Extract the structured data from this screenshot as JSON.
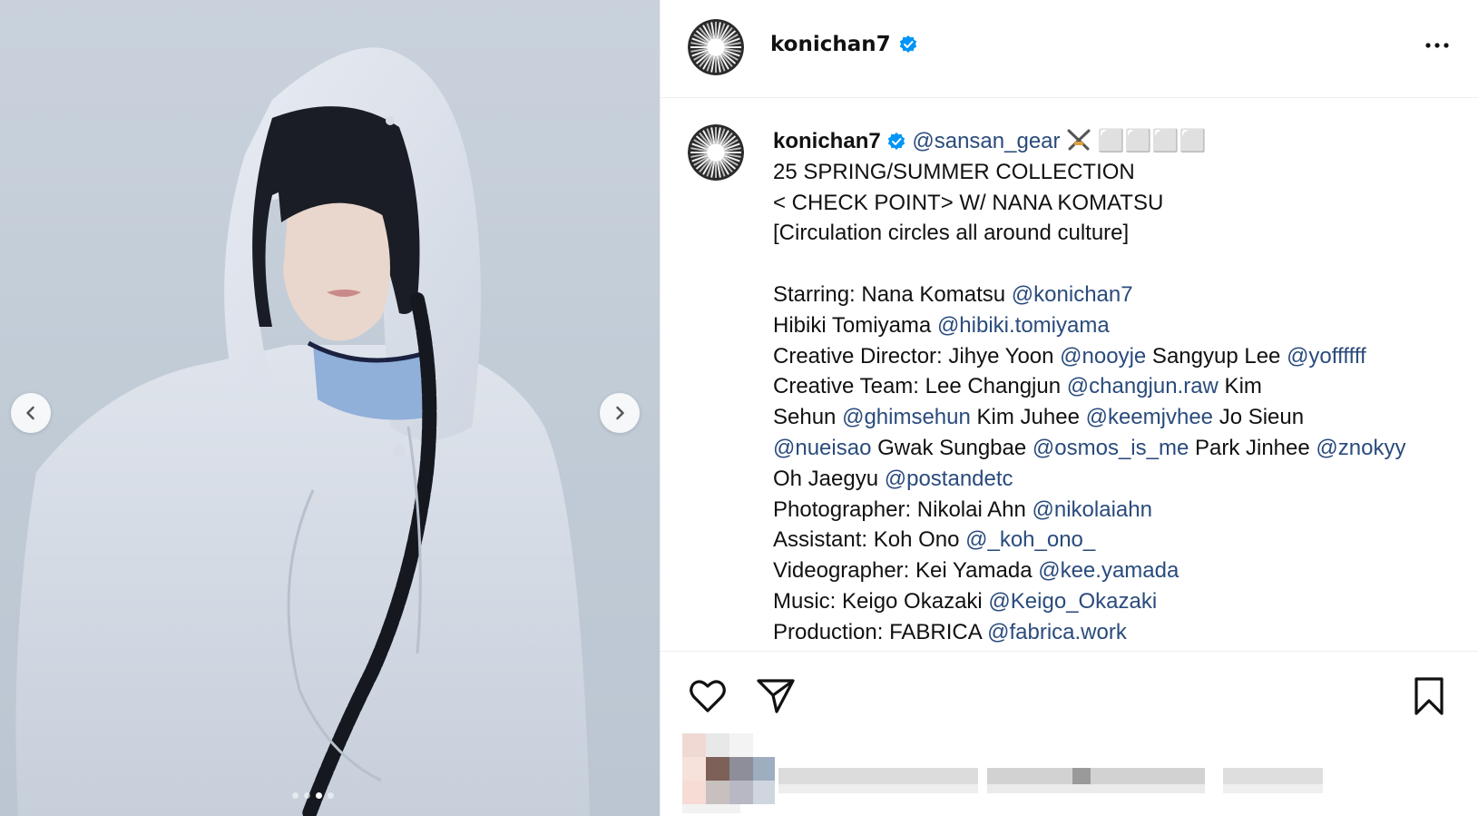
{
  "post": {
    "header": {
      "username": "konichan7",
      "verified_icon": "verified-badge-icon",
      "more_icon": "more-options-icon"
    },
    "media": {
      "prev_icon": "chevron-left-icon",
      "next_icon": "chevron-right-icon",
      "carousel_count": 4,
      "carousel_active_index": 2
    },
    "caption": {
      "username": "konichan7",
      "first_mention": "@sansan_gear",
      "first_line_tail": "⬜⬜⬜⬜",
      "lines": [
        "25 SPRING/SUMMER COLLECTION",
        "< CHECK POINT> W/ NANA KOMATSU",
        "[Circulation circles all around culture]"
      ],
      "credits": [
        [
          {
            "t": "Starring: Nana Komatsu "
          },
          {
            "m": "@konichan7"
          }
        ],
        [
          {
            "t": "Hibiki Tomiyama "
          },
          {
            "m": "@hibiki.tomiyama"
          }
        ],
        [
          {
            "t": "Creative Director: Jihye Yoon "
          },
          {
            "m": "@nooyje"
          },
          {
            "t": " Sangyup Lee "
          },
          {
            "m": "@yoffffff"
          }
        ],
        [
          {
            "t": "Creative Team: Lee Changjun "
          },
          {
            "m": "@changjun.raw"
          },
          {
            "t": " Kim"
          }
        ],
        [
          {
            "t": "Sehun "
          },
          {
            "m": "@ghimsehun"
          },
          {
            "t": " Kim Juhee "
          },
          {
            "m": "@keemjvhee"
          },
          {
            "t": " Jo Sieun"
          }
        ],
        [
          {
            "m": "@nueisao"
          },
          {
            "t": " Gwak Sungbae "
          },
          {
            "m": "@osmos_is_me"
          },
          {
            "t": " Park Jinhee "
          },
          {
            "m": "@znokyy"
          }
        ],
        [
          {
            "t": "Oh Jaegyu "
          },
          {
            "m": "@postandetc"
          }
        ],
        [
          {
            "t": "Photographer: Nikolai Ahn "
          },
          {
            "m": "@nikolaiahn"
          }
        ],
        [
          {
            "t": "Assistant: Koh Ono "
          },
          {
            "m": "@_koh_ono_"
          }
        ],
        [
          {
            "t": "Videographer: Kei Yamada "
          },
          {
            "m": "@kee.yamada"
          }
        ],
        [
          {
            "t": "Music: Keigo Okazaki "
          },
          {
            "m": "@Keigo_Okazaki"
          }
        ],
        [
          {
            "t": "Production: FABRICA "
          },
          {
            "m": "@fabrica.work"
          }
        ]
      ]
    },
    "actions": {
      "like_icon": "heart-icon",
      "share_icon": "send-icon",
      "save_icon": "bookmark-icon"
    },
    "colors": {
      "mention": "#2a4b7c",
      "verified": "#0095f6",
      "divider": "#efefef"
    }
  }
}
